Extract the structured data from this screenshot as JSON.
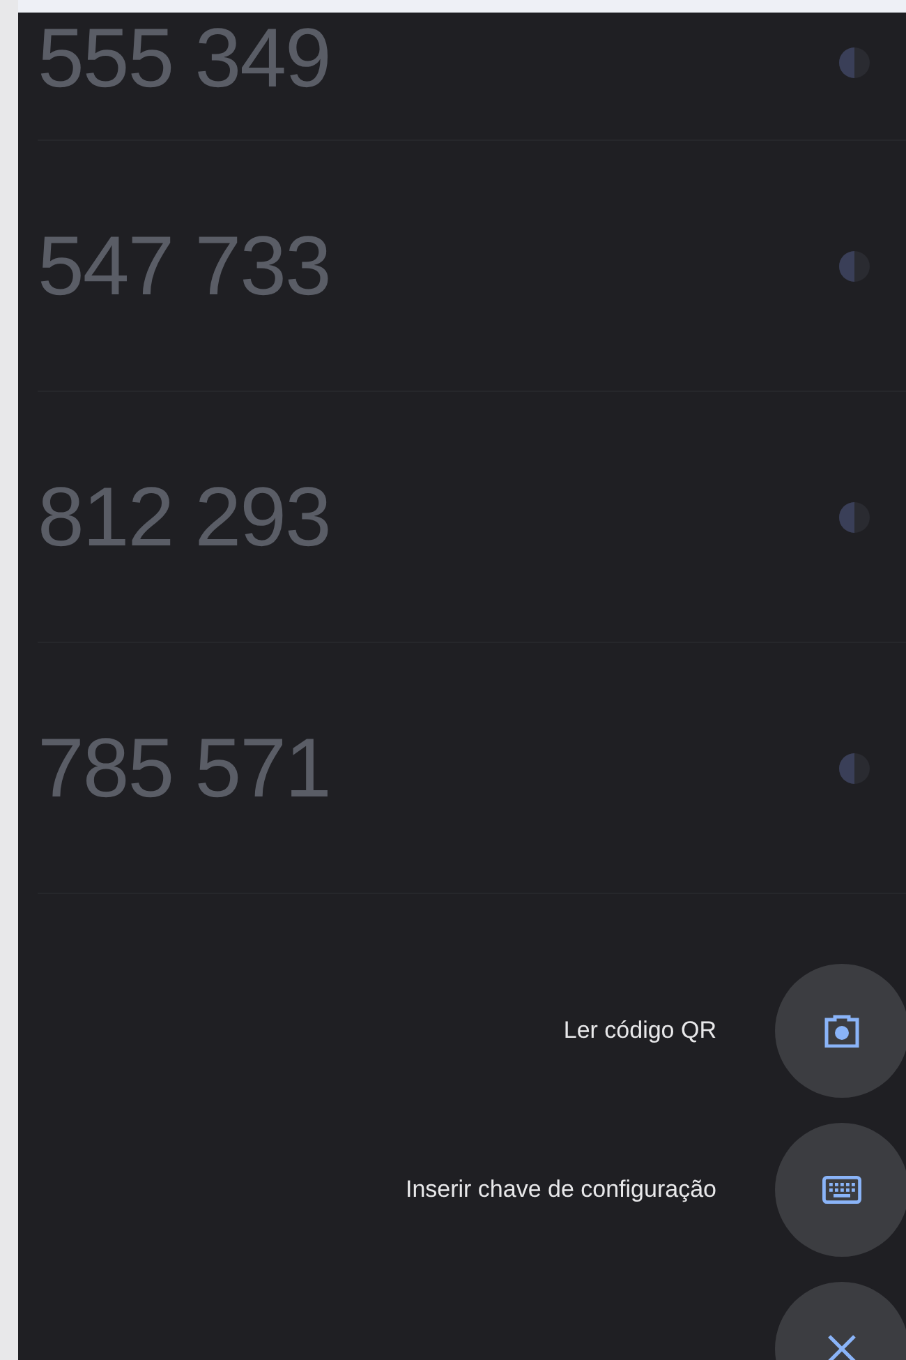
{
  "codes": [
    {
      "code": "555 349",
      "level": 0.5
    },
    {
      "code": "547 733",
      "level": 0.5
    },
    {
      "code": "812 293",
      "level": 0.5
    },
    {
      "code": "785 571",
      "level": 0.5
    }
  ],
  "fab_menu": [
    {
      "kind": "camera",
      "label": "Ler código QR"
    },
    {
      "kind": "keyboard",
      "label": "Inserir chave de configuração"
    }
  ],
  "fab": {
    "kind": "close"
  }
}
